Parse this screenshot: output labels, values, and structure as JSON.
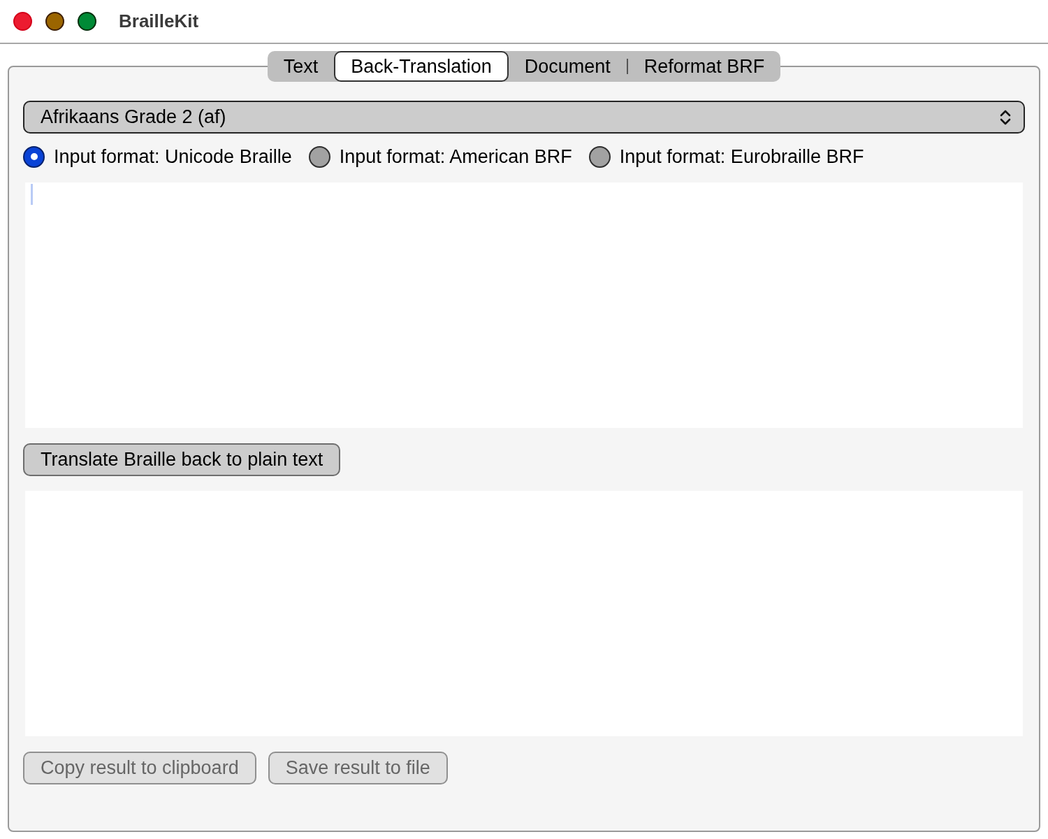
{
  "window": {
    "title": "BrailleKit"
  },
  "tabs": [
    {
      "label": "Text",
      "selected": false
    },
    {
      "label": "Back-Translation",
      "selected": true
    },
    {
      "label": "Document",
      "selected": false
    },
    {
      "label": "Reformat BRF",
      "selected": false
    }
  ],
  "language_select": {
    "value": "Afrikaans Grade 2 (af)"
  },
  "input_formats": [
    {
      "label": "Input format: Unicode Braille",
      "selected": true
    },
    {
      "label": "Input format: American BRF",
      "selected": false
    },
    {
      "label": "Input format: Eurobraille BRF",
      "selected": false
    }
  ],
  "braille_input": {
    "focused": true
  },
  "translate_button": {
    "label": "Translate Braille back to plain text"
  },
  "result_actions": [
    {
      "label": "Copy result to clipboard",
      "disabled": true
    },
    {
      "label": "Save result to file",
      "disabled": true
    }
  ]
}
